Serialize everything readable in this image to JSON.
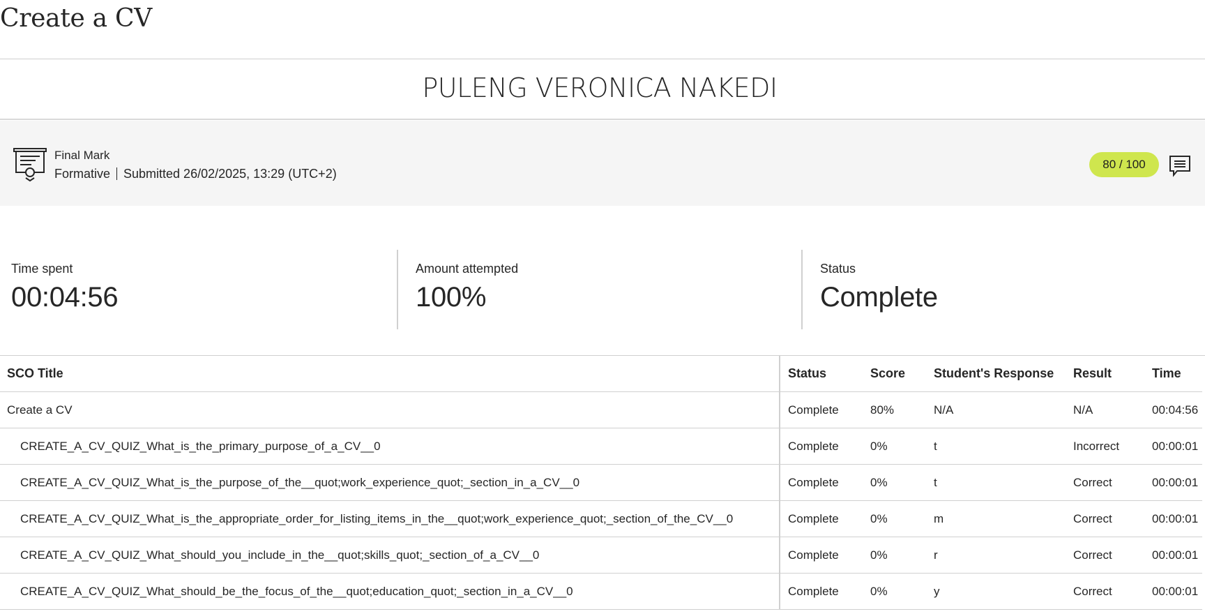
{
  "page": {
    "title": "Create a CV",
    "student_name": "PULENG VERONICA NAKEDI"
  },
  "grade": {
    "icon": "certificate-icon",
    "label": "Final Mark",
    "type": "Formative",
    "submitted": "Submitted 26/02/2025, 13:29 (UTC+2)",
    "score": "80 / 100",
    "score_color": "#cfe64e",
    "feedback_icon": "comment-icon"
  },
  "stats": {
    "time_spent": {
      "label": "Time spent",
      "value": "00:04:56"
    },
    "amount_attempted": {
      "label": "Amount attempted",
      "value": "100%"
    },
    "status": {
      "label": "Status",
      "value": "Complete"
    }
  },
  "table": {
    "headers": [
      "SCO Title",
      "Status",
      "Score",
      "Student's Response",
      "Result",
      "Time"
    ],
    "rows": [
      {
        "title": "Create a CV",
        "status": "Complete",
        "score": "80%",
        "response": "N/A",
        "result": "N/A",
        "time": "00:04:56"
      },
      {
        "title": "CREATE_A_CV_QUIZ_What_is_the_primary_purpose_of_a_CV__0",
        "status": "Complete",
        "score": "0%",
        "response": "t",
        "result": "Incorrect",
        "time": "00:00:01"
      },
      {
        "title": "CREATE_A_CV_QUIZ_What_is_the_purpose_of_the__quot;work_experience_quot;_section_in_a_CV__0",
        "status": "Complete",
        "score": "0%",
        "response": "t",
        "result": "Correct",
        "time": "00:00:01"
      },
      {
        "title": "CREATE_A_CV_QUIZ_What_is_the_appropriate_order_for_listing_items_in_the__quot;work_experience_quot;_section_of_the_CV__0",
        "status": "Complete",
        "score": "0%",
        "response": "m",
        "result": "Correct",
        "time": "00:00:01"
      },
      {
        "title": "CREATE_A_CV_QUIZ_What_should_you_include_in_the__quot;skills_quot;_section_of_a_CV__0",
        "status": "Complete",
        "score": "0%",
        "response": "r",
        "result": "Correct",
        "time": "00:00:01"
      },
      {
        "title": "CREATE_A_CV_QUIZ_What_should_be_the_focus_of_the__quot;education_quot;_section_in_a_CV__0",
        "status": "Complete",
        "score": "0%",
        "response": "y",
        "result": "Correct",
        "time": "00:00:01"
      }
    ]
  }
}
